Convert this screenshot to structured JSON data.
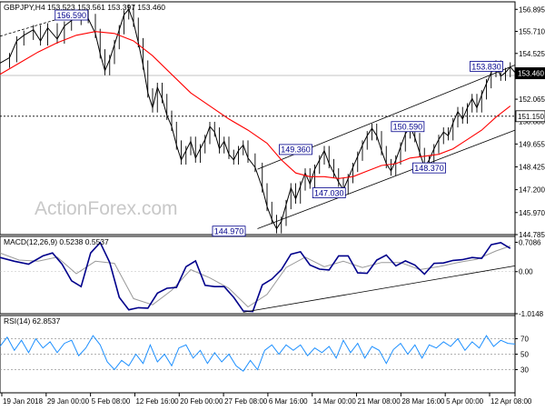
{
  "chart_data": {
    "type": "line",
    "watermark": "ActionForex.com",
    "x_ticks": [
      "19 Jan 2018",
      "29 Jan 00:00",
      "5 Feb 08:00",
      "12 Feb 16:00",
      "20 Feb 00:00",
      "27 Feb 08:00",
      "6 Mar 16:00",
      "14 Mar 00:00",
      "21 Mar 08:00",
      "28 Mar 16:00",
      "5 Apr 00:00",
      "12 Apr 08:00"
    ],
    "colors": {
      "price": "#000000",
      "ema": "#ff0000",
      "macd": "#00008b",
      "signal": "#9a9a9a",
      "rsi": "#1e90ff",
      "label_border": "#00008b"
    },
    "panels": [
      {
        "id": "price",
        "header": "GBPJPY,H4  153.523 153.561 153.397 153.460",
        "ylim": [
          144.785,
          157.3
        ],
        "y_ticks": [
          "156.895",
          "155.710",
          "154.525",
          "153.340",
          "152.065",
          "150.880",
          "149.655",
          "148.425",
          "147.200",
          "145.970",
          "144.785"
        ],
        "current": "153.460",
        "hline_labels": [
          {
            "value": 151.15,
            "label": "151.150"
          }
        ],
        "hlines": [
          153.34
        ],
        "price_path": [
          [
            0,
            154.0
          ],
          [
            4,
            154.3
          ],
          [
            7,
            155.2
          ],
          [
            10,
            155.5
          ],
          [
            14,
            155.8
          ],
          [
            17,
            155.2
          ],
          [
            20,
            155.9
          ],
          [
            24,
            155.3
          ],
          [
            27,
            156.0
          ],
          [
            30,
            156.3
          ],
          [
            34,
            156.6
          ],
          [
            37,
            156.4
          ],
          [
            40,
            155.6
          ],
          [
            42,
            154.5
          ],
          [
            44,
            153.6
          ],
          [
            46,
            154.2
          ],
          [
            48,
            155.0
          ],
          [
            50,
            155.8
          ],
          [
            52,
            156.6
          ],
          [
            54,
            156.9
          ],
          [
            56,
            156.2
          ],
          [
            58,
            155.1
          ],
          [
            60,
            153.9
          ],
          [
            62,
            152.4
          ],
          [
            64,
            151.6
          ],
          [
            66,
            152.7
          ],
          [
            68,
            152.1
          ],
          [
            70,
            151.2
          ],
          [
            72,
            150.6
          ],
          [
            74,
            149.6
          ],
          [
            76,
            148.8
          ],
          [
            78,
            149.3
          ],
          [
            80,
            149.8
          ],
          [
            82,
            148.9
          ],
          [
            84,
            149.4
          ],
          [
            86,
            149.9
          ],
          [
            88,
            150.6
          ],
          [
            90,
            150.3
          ],
          [
            92,
            149.4
          ],
          [
            94,
            149.8
          ],
          [
            96,
            149.1
          ],
          [
            98,
            148.8
          ],
          [
            100,
            149.3
          ],
          [
            102,
            149.6
          ],
          [
            104,
            148.9
          ],
          [
            107,
            148.4
          ],
          [
            110,
            147.3
          ],
          [
            112,
            146.3
          ],
          [
            114,
            145.6
          ],
          [
            116,
            145.1
          ],
          [
            118,
            145.5
          ],
          [
            120,
            146.4
          ],
          [
            122,
            147.3
          ],
          [
            124,
            146.7
          ],
          [
            126,
            147.4
          ],
          [
            128,
            148.1
          ],
          [
            130,
            147.5
          ],
          [
            132,
            148.3
          ],
          [
            134,
            148.8
          ],
          [
            136,
            149.3
          ],
          [
            138,
            148.6
          ],
          [
            140,
            148.1
          ],
          [
            142,
            147.6
          ],
          [
            144,
            147.2
          ],
          [
            146,
            147.8
          ],
          [
            148,
            148.4
          ],
          [
            150,
            149.0
          ],
          [
            152,
            149.6
          ],
          [
            154,
            150.1
          ],
          [
            156,
            150.5
          ],
          [
            158,
            150.1
          ],
          [
            160,
            149.3
          ],
          [
            162,
            148.6
          ],
          [
            164,
            148.2
          ],
          [
            166,
            148.8
          ],
          [
            168,
            149.5
          ],
          [
            170,
            150.2
          ],
          [
            172,
            150.6
          ],
          [
            174,
            150.0
          ],
          [
            176,
            149.2
          ],
          [
            178,
            148.4
          ],
          [
            180,
            148.8
          ],
          [
            182,
            149.4
          ],
          [
            184,
            149.9
          ],
          [
            186,
            150.3
          ],
          [
            188,
            150.1
          ],
          [
            190,
            150.8
          ],
          [
            192,
            151.4
          ],
          [
            194,
            151.0
          ],
          [
            196,
            151.6
          ],
          [
            198,
            152.1
          ],
          [
            200,
            151.6
          ],
          [
            202,
            152.3
          ],
          [
            204,
            152.9
          ],
          [
            206,
            153.5
          ],
          [
            208,
            153.9
          ],
          [
            210,
            153.3
          ],
          [
            212,
            153.5
          ],
          [
            214,
            153.8
          ],
          [
            216,
            153.5
          ]
        ],
        "ema_path": [
          [
            0,
            153.4
          ],
          [
            8,
            154.0
          ],
          [
            16,
            154.6
          ],
          [
            24,
            155.1
          ],
          [
            32,
            155.5
          ],
          [
            40,
            155.7
          ],
          [
            48,
            155.6
          ],
          [
            56,
            155.2
          ],
          [
            64,
            154.4
          ],
          [
            72,
            153.4
          ],
          [
            80,
            152.4
          ],
          [
            88,
            151.7
          ],
          [
            96,
            151.0
          ],
          [
            104,
            150.4
          ],
          [
            112,
            149.7
          ],
          [
            118,
            148.8
          ],
          [
            124,
            148.1
          ],
          [
            130,
            147.9
          ],
          [
            136,
            147.9
          ],
          [
            142,
            147.8
          ],
          [
            148,
            147.9
          ],
          [
            154,
            148.2
          ],
          [
            160,
            148.5
          ],
          [
            166,
            148.6
          ],
          [
            172,
            148.9
          ],
          [
            178,
            149.0
          ],
          [
            184,
            149.1
          ],
          [
            190,
            149.4
          ],
          [
            196,
            149.9
          ],
          [
            202,
            150.4
          ],
          [
            208,
            151.1
          ],
          [
            214,
            151.7
          ]
        ],
        "channel": {
          "upper": [
            [
              108,
              148.3
            ],
            [
              216,
              153.9
            ]
          ],
          "lower": [
            [
              108,
              145.1
            ],
            [
              216,
              150.4
            ]
          ]
        },
        "labels": [
          {
            "text": "156.590",
            "x": 30,
            "y": 156.59
          },
          {
            "text": "149.360",
            "x": 124,
            "y": 149.36
          },
          {
            "text": "147.030",
            "x": 138,
            "y": 147.03
          },
          {
            "text": "150.590",
            "x": 171,
            "y": 150.59
          },
          {
            "text": "148.370",
            "x": 180,
            "y": 148.37
          },
          {
            "text": "153.830",
            "x": 204,
            "y": 153.83
          },
          {
            "text": "144.970",
            "x": 96,
            "y": 144.97
          }
        ]
      },
      {
        "id": "macd",
        "header": "MACD(12,26,9) 0.5238 0.5537",
        "ylim": [
          -1.0148,
          0.85
        ],
        "y_ticks": [
          "0.7086",
          "0.00",
          "-1.0148"
        ],
        "macd_path": [
          [
            0,
            0.34
          ],
          [
            6,
            0.25
          ],
          [
            12,
            0.18
          ],
          [
            18,
            0.38
          ],
          [
            22,
            0.45
          ],
          [
            26,
            0.18
          ],
          [
            30,
            -0.22
          ],
          [
            34,
            -0.36
          ],
          [
            38,
            0.45
          ],
          [
            42,
            0.7
          ],
          [
            46,
            0.22
          ],
          [
            50,
            -0.62
          ],
          [
            54,
            -0.92
          ],
          [
            58,
            -0.87
          ],
          [
            62,
            -0.88
          ],
          [
            66,
            -0.52
          ],
          [
            70,
            -0.4
          ],
          [
            74,
            -0.38
          ],
          [
            78,
            0.12
          ],
          [
            82,
            0.26
          ],
          [
            86,
            -0.33
          ],
          [
            90,
            -0.36
          ],
          [
            94,
            -0.36
          ],
          [
            98,
            -0.62
          ],
          [
            102,
            -0.95
          ],
          [
            106,
            -0.96
          ],
          [
            110,
            -0.32
          ],
          [
            114,
            -0.18
          ],
          [
            118,
            0.05
          ],
          [
            122,
            0.42
          ],
          [
            126,
            0.48
          ],
          [
            130,
            0.16
          ],
          [
            134,
            0.06
          ],
          [
            138,
            0.04
          ],
          [
            142,
            0.38
          ],
          [
            146,
            0.38
          ],
          [
            150,
            -0.03
          ],
          [
            154,
            -0.04
          ],
          [
            158,
            0.28
          ],
          [
            162,
            0.4
          ],
          [
            166,
            0.14
          ],
          [
            170,
            0.26
          ],
          [
            174,
            0.16
          ],
          [
            178,
            -0.06
          ],
          [
            182,
            0.2
          ],
          [
            186,
            0.21
          ],
          [
            190,
            0.27
          ],
          [
            194,
            0.29
          ],
          [
            198,
            0.34
          ],
          [
            202,
            0.32
          ],
          [
            206,
            0.65
          ],
          [
            210,
            0.7
          ],
          [
            214,
            0.56
          ]
        ],
        "signal_path": [
          [
            0,
            0.45
          ],
          [
            8,
            0.28
          ],
          [
            16,
            0.25
          ],
          [
            24,
            0.35
          ],
          [
            32,
            -0.05
          ],
          [
            40,
            0.25
          ],
          [
            48,
            0.2
          ],
          [
            56,
            -0.65
          ],
          [
            64,
            -0.8
          ],
          [
            72,
            -0.45
          ],
          [
            80,
            0.05
          ],
          [
            88,
            -0.15
          ],
          [
            96,
            -0.4
          ],
          [
            104,
            -0.85
          ],
          [
            112,
            -0.55
          ],
          [
            120,
            0.1
          ],
          [
            128,
            0.35
          ],
          [
            136,
            0.12
          ],
          [
            144,
            0.25
          ],
          [
            152,
            0.1
          ],
          [
            160,
            0.22
          ],
          [
            168,
            0.22
          ],
          [
            176,
            0.05
          ],
          [
            184,
            0.12
          ],
          [
            192,
            0.22
          ],
          [
            200,
            0.3
          ],
          [
            208,
            0.5
          ],
          [
            214,
            0.62
          ]
        ],
        "trendline": [
          [
            102,
            -0.98
          ],
          [
            216,
            0.14
          ]
        ]
      },
      {
        "id": "rsi",
        "header": "RSI(14) 62.8537",
        "ylim": [
          0,
          100
        ],
        "y_ticks": [
          "70",
          "50",
          "30"
        ],
        "levels": [
          70,
          50,
          30
        ],
        "rsi_path": [
          [
            0,
            60
          ],
          [
            3,
            72
          ],
          [
            6,
            55
          ],
          [
            9,
            68
          ],
          [
            12,
            52
          ],
          [
            15,
            70
          ],
          [
            18,
            58
          ],
          [
            21,
            66
          ],
          [
            24,
            52
          ],
          [
            27,
            64
          ],
          [
            30,
            68
          ],
          [
            33,
            48
          ],
          [
            36,
            58
          ],
          [
            39,
            74
          ],
          [
            42,
            62
          ],
          [
            45,
            40
          ],
          [
            48,
            30
          ],
          [
            51,
            42
          ],
          [
            54,
            35
          ],
          [
            57,
            50
          ],
          [
            60,
            38
          ],
          [
            63,
            62
          ],
          [
            66,
            40
          ],
          [
            69,
            50
          ],
          [
            72,
            35
          ],
          [
            75,
            58
          ],
          [
            78,
            62
          ],
          [
            81,
            45
          ],
          [
            84,
            55
          ],
          [
            87,
            38
          ],
          [
            90,
            52
          ],
          [
            93,
            40
          ],
          [
            96,
            50
          ],
          [
            99,
            35
          ],
          [
            102,
            28
          ],
          [
            105,
            42
          ],
          [
            108,
            30
          ],
          [
            111,
            55
          ],
          [
            114,
            62
          ],
          [
            117,
            50
          ],
          [
            120,
            62
          ],
          [
            123,
            55
          ],
          [
            126,
            62
          ],
          [
            129,
            48
          ],
          [
            132,
            58
          ],
          [
            135,
            52
          ],
          [
            138,
            60
          ],
          [
            141,
            45
          ],
          [
            144,
            68
          ],
          [
            147,
            52
          ],
          [
            150,
            64
          ],
          [
            153,
            45
          ],
          [
            156,
            60
          ],
          [
            159,
            55
          ],
          [
            162,
            38
          ],
          [
            165,
            56
          ],
          [
            168,
            64
          ],
          [
            171,
            50
          ],
          [
            174,
            62
          ],
          [
            177,
            45
          ],
          [
            180,
            62
          ],
          [
            183,
            58
          ],
          [
            186,
            66
          ],
          [
            189,
            60
          ],
          [
            192,
            70
          ],
          [
            195,
            55
          ],
          [
            198,
            66
          ],
          [
            201,
            58
          ],
          [
            204,
            74
          ],
          [
            207,
            60
          ],
          [
            210,
            68
          ],
          [
            213,
            64
          ],
          [
            216,
            63
          ]
        ]
      }
    ]
  }
}
